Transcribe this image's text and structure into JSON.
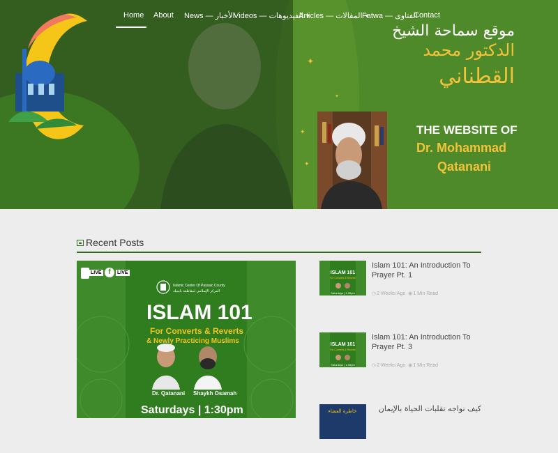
{
  "nav": {
    "items": [
      {
        "label": "Home",
        "active": true
      },
      {
        "label": "About"
      },
      {
        "label": "News — الأخبار"
      },
      {
        "label": "Videos — الفيديوهات",
        "dropdown": true
      },
      {
        "label": "Articles — المقالات",
        "dropdown": true
      },
      {
        "label": "Fatwa — الفتاوى"
      },
      {
        "label": "Contact"
      }
    ]
  },
  "hero": {
    "arabic_line1": "موقع سماحة الشيخ",
    "arabic_line2": "الدكتور محمد",
    "arabic_line3": "القطناني",
    "english_line1": "THE WEBSITE OF",
    "english_line2": "Dr. Mohammad",
    "english_line3": "Qatanani"
  },
  "recent": {
    "title": "Recent Posts",
    "icon": "newspaper-icon",
    "featured": {
      "live_badge": "LIVE",
      "org_en": "Islamic Center Of Passaic County",
      "org_ar": "المركز الإسلامي لمقاطعة باسيك",
      "title": "ISLAM 101",
      "subtitle1": "For Converts & Reverts",
      "subtitle2": "& Newly Practicing Muslims",
      "speaker1": "Dr. Qatanani",
      "speaker2": "Shaykh Osamah",
      "schedule": "Saturdays | 1:30pm"
    },
    "posts": [
      {
        "title": "Islam 101: An Introduction To Prayer Pt. 1",
        "date": "2 Weeks Ago",
        "read": "1 Min Read"
      },
      {
        "title": "Islam 101: An Introduction To Prayer Pt. 3",
        "date": "2 Weeks Ago",
        "read": "1 Min Read"
      },
      {
        "title": "كيف نواجه تقلبات الحياة بالإيمان",
        "thumb_text": "خاطرة العشاء"
      }
    ],
    "thumb_text": {
      "title": "ISLAM 101",
      "line": "For Converts & Reverts",
      "sched": "Saturdays | 1:30pm"
    }
  },
  "colors": {
    "green": "#4f8a2a",
    "dark_green": "#2e6b1e",
    "gold": "#f2c23a",
    "bg": "#ededed"
  }
}
